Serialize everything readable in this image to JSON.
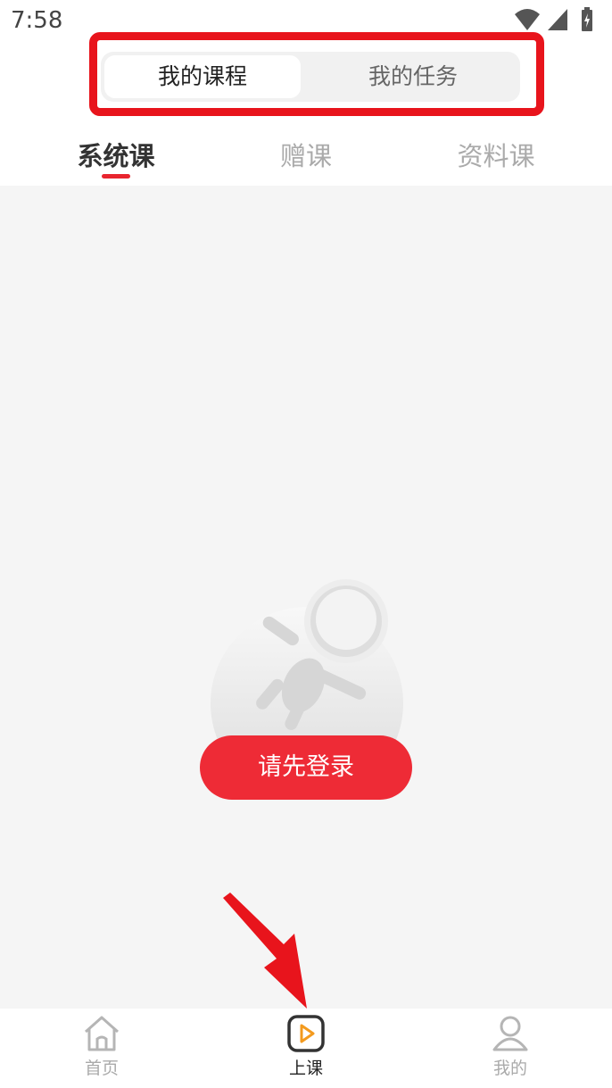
{
  "status_bar": {
    "time": "7:58"
  },
  "segment": {
    "tabs": [
      {
        "label": "我的课程",
        "active": true
      },
      {
        "label": "我的任务",
        "active": false
      }
    ]
  },
  "category_tabs": [
    {
      "label": "系统课",
      "active": true
    },
    {
      "label": "赠课",
      "active": false
    },
    {
      "label": "资料课",
      "active": false
    }
  ],
  "empty_state": {
    "login_button": "请先登录"
  },
  "bottom_nav": [
    {
      "label": "首页",
      "icon": "home-icon",
      "active": false
    },
    {
      "label": "上课",
      "icon": "play-class-icon",
      "active": true
    },
    {
      "label": "我的",
      "icon": "user-icon",
      "active": false
    }
  ],
  "colors": {
    "accent": "#ee2b36",
    "annotation": "#e8141c"
  }
}
